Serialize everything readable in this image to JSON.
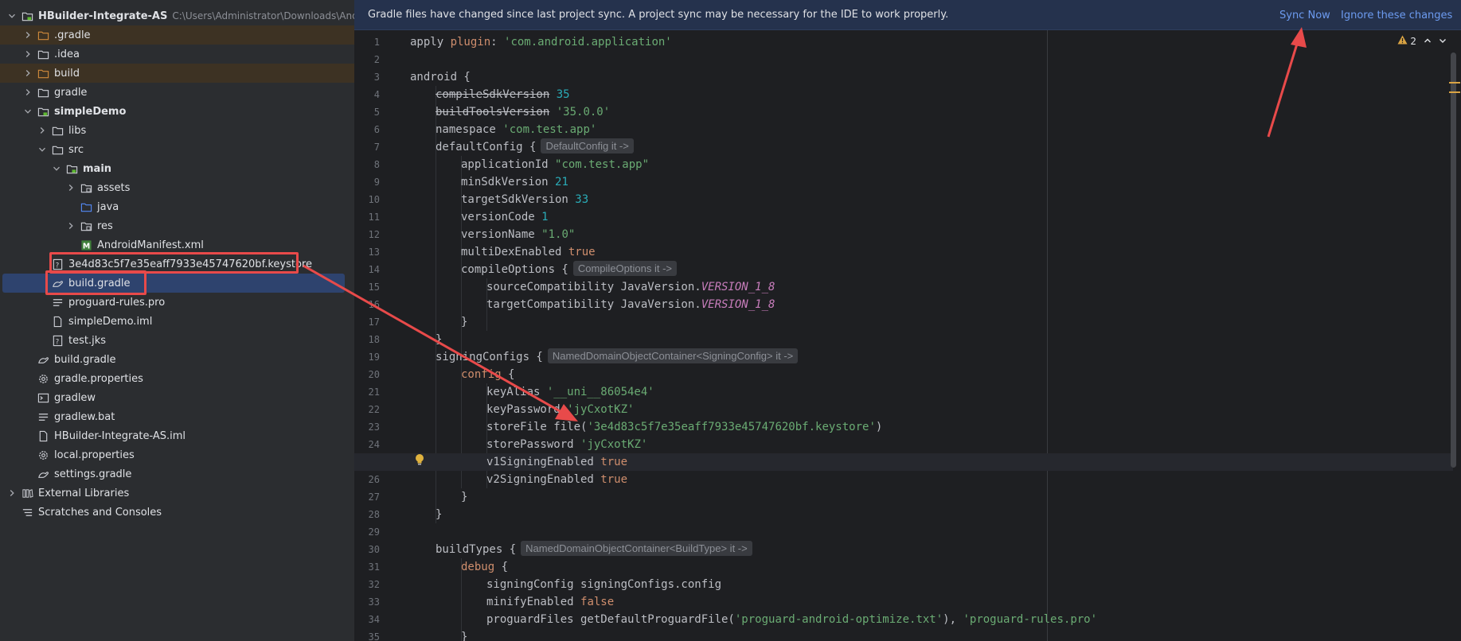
{
  "project_tree": {
    "root": {
      "label": "HBuilder-Integrate-AS",
      "path": "C:\\Users\\Administrator\\Downloads\\Android-"
    },
    "items": [
      {
        "label": ".gradle"
      },
      {
        "label": ".idea"
      },
      {
        "label": "build"
      },
      {
        "label": "gradle"
      },
      {
        "label": "simpleDemo"
      },
      {
        "label": "libs"
      },
      {
        "label": "src"
      },
      {
        "label": "main"
      },
      {
        "label": "assets"
      },
      {
        "label": "java"
      },
      {
        "label": "res"
      },
      {
        "label": "AndroidManifest.xml"
      },
      {
        "label": "3e4d83c5f7e35eaff7933e45747620bf.keystore"
      },
      {
        "label": "build.gradle"
      },
      {
        "label": "proguard-rules.pro"
      },
      {
        "label": "simpleDemo.iml"
      },
      {
        "label": "test.jks"
      },
      {
        "label": "build.gradle"
      },
      {
        "label": "gradle.properties"
      },
      {
        "label": "gradlew"
      },
      {
        "label": "gradlew.bat"
      },
      {
        "label": "HBuilder-Integrate-AS.iml"
      },
      {
        "label": "local.properties"
      },
      {
        "label": "settings.gradle"
      },
      {
        "label": "External Libraries"
      },
      {
        "label": "Scratches and Consoles"
      }
    ]
  },
  "banner": {
    "message": "Gradle files have changed since last project sync. A project sync may be necessary for the IDE to work properly.",
    "sync_now": "Sync Now",
    "ignore": "Ignore these changes"
  },
  "editor": {
    "problems_count": "2",
    "current_line": 25,
    "code": {
      "l1a": "apply ",
      "l1b": "plugin",
      "l1c": ": ",
      "l1d": "'com.android.application'",
      "l3a": "android {",
      "l4a": "compileSdkVersion",
      "l4b": "35",
      "l5a": "buildToolsVersion",
      "l5b": "'35.0.0'",
      "l6a": "namespace ",
      "l6b": "'com.test.app'",
      "l7a": "defaultConfig {",
      "l7h": "DefaultConfig it ->",
      "l8a": "applicationId ",
      "l8b": "\"com.test.app\"",
      "l9a": "minSdkVersion ",
      "l9b": "21",
      "l10a": "targetSdkVersion ",
      "l10b": "33",
      "l11a": "versionCode ",
      "l11b": "1",
      "l12a": "versionName ",
      "l12b": "\"1.0\"",
      "l13a": "multiDexEnabled ",
      "l13b": "true",
      "l14a": "compileOptions {",
      "l14h": "CompileOptions it ->",
      "l15a": "sourceCompatibility JavaVersion.",
      "l15b": "VERSION_1_8",
      "l16a": "targetCompatibility JavaVersion.",
      "l16b": "VERSION_1_8",
      "l17a": "}",
      "l18a": "}",
      "l19a": "signingConfigs {",
      "l19h": "NamedDomainObjectContainer<SigningConfig> it ->",
      "l20a": "config",
      "l20b": " {",
      "l21a": "keyAlias ",
      "l21b": "'__uni__86054e4'",
      "l22a": "keyPassword ",
      "l22b": "'jyCxotKZ'",
      "l23a": "storeFile file(",
      "l23b": "'3e4d83c5f7e35eaff7933e45747620bf.keystore'",
      "l23c": ")",
      "l24a": "storePassword ",
      "l24b": "'jyCxotKZ'",
      "l25a": "v1SigningEnabled ",
      "l25b": "true",
      "l26a": "v2SigningEnabled ",
      "l26b": "true",
      "l27a": "}",
      "l28a": "}",
      "l30a": "buildTypes {",
      "l30h": "NamedDomainObjectContainer<BuildType> it ->",
      "l31a": "debug",
      "l31b": " {",
      "l32a": "signingConfig signingConfigs.config",
      "l33a": "minifyEnabled ",
      "l33b": "false",
      "l34a": "proguardFiles getDefaultProguardFile(",
      "l34b": "'proguard-android-optimize.txt'",
      "l34c": "), ",
      "l34d": "'proguard-rules.pro'",
      "l35a": "}"
    }
  },
  "colors": {
    "annotation": "#e84a4a",
    "selection": "#2e436e",
    "link": "#6c9bf0"
  }
}
